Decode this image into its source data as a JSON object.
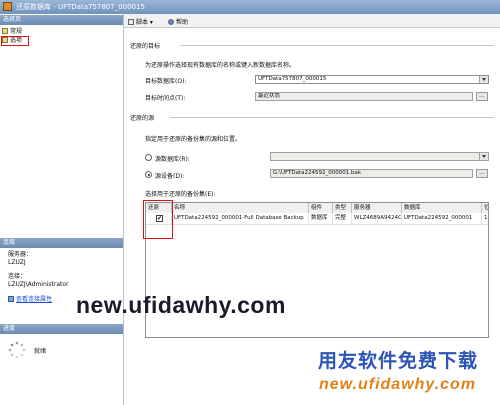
{
  "window": {
    "title": "还原数据库 - UFTData757807_000015"
  },
  "left": {
    "select_page_header": "选择页",
    "nav_items": [
      {
        "label": "常规"
      },
      {
        "label": "选项"
      }
    ],
    "connection_header": "连接",
    "server_label": "服务器：",
    "server_value": "LZUZJ",
    "connection_label": "连接：",
    "connection_value": "LZUZJ\\Administrator",
    "view_connection_link": "查看连接属性",
    "progress_header": "进度",
    "progress_status": "就绪"
  },
  "toolbar": {
    "script_label": "脚本",
    "help_label": "帮助"
  },
  "main": {
    "target_section": "还原的目标",
    "target_desc": "为还原操作选择现有数据库的名称或键入新数据库名称。",
    "target_db_label": "目标数据库(O):",
    "target_db_value": "UFTData757807_000015",
    "target_time_label": "目标时间点(T):",
    "target_time_value": "最近状态",
    "source_section": "还原的源",
    "source_desc": "指定用于还原的备份集的源和位置。",
    "from_db_label": "源数据库(R):",
    "from_db_value": "",
    "from_device_label": "源设备(D):",
    "from_device_value": "G:\\UFTData224592_000001.bak",
    "backup_sets_label": "选择用于还原的备份集(E):",
    "grid": {
      "columns": [
        "还原",
        "名称",
        "组件",
        "类型",
        "服务器",
        "数据库",
        "位"
      ],
      "rows": [
        {
          "restore_checked": "✔",
          "name": "UFTData224592_000001-Full Database Backup",
          "component": "数据库",
          "type": "完整",
          "server": "WLZ4689A9424CC",
          "database": "UFTData224592_000001",
          "position": "1"
        }
      ]
    }
  },
  "watermark": {
    "url": "new.ufidawhy.com",
    "brand_cn": "用友软件免费下载",
    "brand_url": "new.ufidawhy.com"
  },
  "colors": {
    "title_bar": "#6f93c0",
    "highlight_box": "#e01010",
    "brand_blue": "#2c54b6",
    "brand_orange": "#e38018"
  }
}
